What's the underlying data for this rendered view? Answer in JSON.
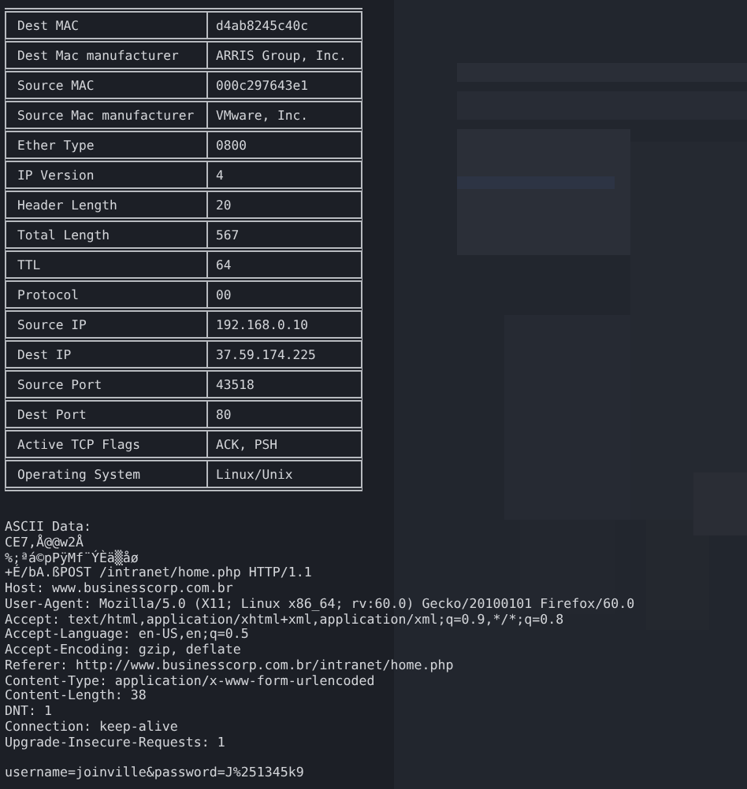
{
  "table": {
    "rows": [
      {
        "field": "Dest MAC",
        "value": "d4ab8245c40c"
      },
      {
        "field": "Dest Mac manufacturer",
        "value": "ARRIS Group, Inc."
      },
      {
        "field": "Source MAC",
        "value": "000c297643e1"
      },
      {
        "field": "Source Mac manufacturer",
        "value": "VMware, Inc."
      },
      {
        "field": "Ether Type",
        "value": "0800"
      },
      {
        "field": "IP Version",
        "value": "4"
      },
      {
        "field": "Header Length",
        "value": "20"
      },
      {
        "field": "Total Length",
        "value": "567"
      },
      {
        "field": "TTL",
        "value": "64"
      },
      {
        "field": "Protocol",
        "value": "00"
      },
      {
        "field": "Source IP",
        "value": "192.168.0.10"
      },
      {
        "field": "Dest IP",
        "value": "37.59.174.225"
      },
      {
        "field": "Source Port",
        "value": "43518"
      },
      {
        "field": "Dest Port",
        "value": "80"
      },
      {
        "field": "Active TCP Flags",
        "value": "ACK, PSH"
      },
      {
        "field": "Operating System",
        "value": "Linux/Unix"
      }
    ]
  },
  "ascii_data": {
    "label": "ASCII Data:",
    "lines": [
      "CE7,Å@@w2Å",
      "%;ªá©pPÿMf¨ÝÈä▒åø",
      "+É/bA.ßPOST /intranet/home.php HTTP/1.1",
      "Host: www.businesscorp.com.br",
      "User-Agent: Mozilla/5.0 (X11; Linux x86_64; rv:60.0) Gecko/20100101 Firefox/60.0",
      "Accept: text/html,application/xhtml+xml,application/xml;q=0.9,*/*;q=0.8",
      "Accept-Language: en-US,en;q=0.5",
      "Accept-Encoding: gzip, deflate",
      "Referer: http://www.businesscorp.com.br/intranet/home.php",
      "Content-Type: application/x-www-form-urlencoded",
      "Content-Length: 38",
      "DNT: 1",
      "Connection: keep-alive",
      "Upgrade-Insecure-Requests: 1"
    ],
    "body": "username=joinville&password=J%251345k9"
  }
}
